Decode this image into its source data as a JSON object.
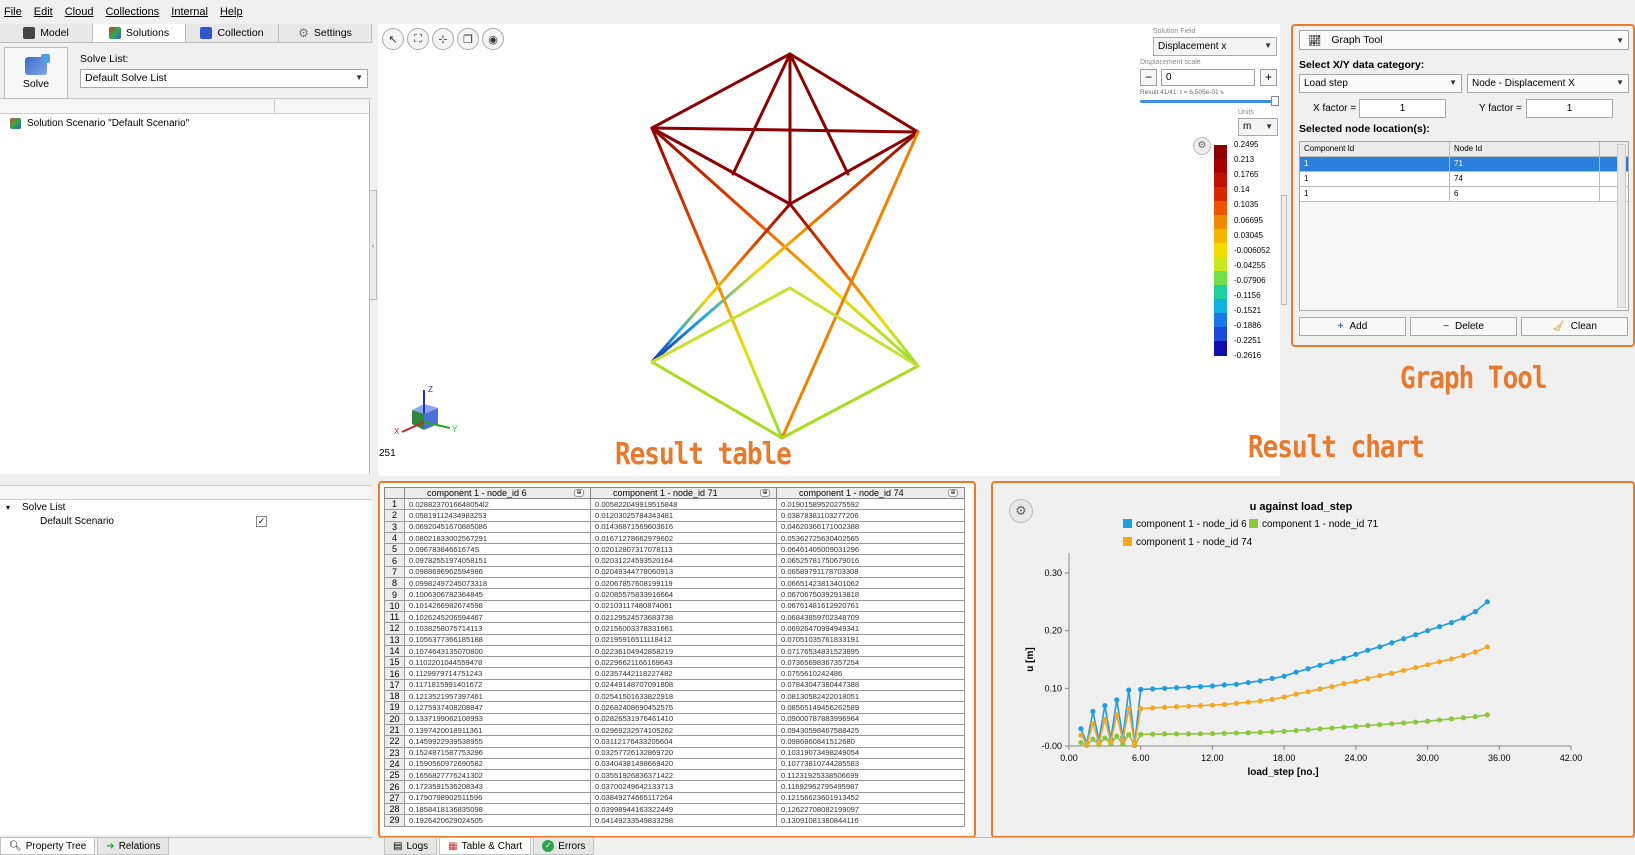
{
  "menu": [
    "File",
    "Edit",
    "Cloud",
    "Collections",
    "Internal",
    "Help"
  ],
  "left_tabs": [
    {
      "label": "Model",
      "icon": "model-icon",
      "color": "#444444"
    },
    {
      "label": "Solutions",
      "icon": "solutions-icon",
      "color": "#cc3322"
    },
    {
      "label": "Collection",
      "icon": "collection-icon",
      "color": "#3355cc"
    },
    {
      "label": "Settings",
      "icon": "gear-icon",
      "color": "#888888"
    }
  ],
  "solve": {
    "button_label": "Solve",
    "list_label": "Solve List:",
    "list_value": "Default Solve List"
  },
  "scenario": {
    "item": "Solution Scenario \"Default Scenario\""
  },
  "tree": {
    "root": "Solve List",
    "child": "Default Scenario",
    "checked": "✓"
  },
  "left_bottom_tabs": [
    {
      "label": "Property Tree",
      "icon": "search-icon"
    },
    {
      "label": "Relations",
      "icon": "arrow-icon"
    }
  ],
  "viewport": {
    "tools": [
      "select-icon",
      "fit-view-icon",
      "axes-icon",
      "layers-icon",
      "eye-icon"
    ],
    "solution_field_label": "Solution Field",
    "solution_field": "Displacement x",
    "displacement_scale_label": "Displacement scale",
    "displacement_scale": "0",
    "result_text": "Result 41/41: t = 6.505e-01 s",
    "result_progress": 1.0,
    "units_label": "Units",
    "units": "m",
    "frame_count": "251",
    "colorbar_labels": [
      "0.2495",
      "0.213",
      "0.1765",
      "0.14",
      "0.1035",
      "0.06695",
      "0.03045",
      "-0.006052",
      "-0.04255",
      "-0.07906",
      "-0.1156",
      "-0.1521",
      "-0.1886",
      "-0.2251",
      "-0.2616"
    ],
    "colorbar_colors": [
      "#8b0000",
      "#a50000",
      "#c01000",
      "#d82800",
      "#ee5500",
      "#f08a00",
      "#f4b400",
      "#f2dc00",
      "#c8e820",
      "#6fe04a",
      "#20cfa0",
      "#10b0e0",
      "#1a78e8",
      "#1e48d8",
      "#1010a8"
    ],
    "triad_labels": {
      "x": "X",
      "y": "Y",
      "z": "Z"
    }
  },
  "graph_tool": {
    "title": "Graph Tool",
    "category_label": "Select X/Y data category:",
    "x_category": "Load step",
    "y_category": "Node - Displacement X",
    "x_factor_label": "X factor =",
    "x_factor": "1",
    "y_factor_label": "Y factor =",
    "y_factor": "1",
    "nodes_label": "Selected node location(s):",
    "columns": [
      "Component Id",
      "Node Id"
    ],
    "rows": [
      [
        "1",
        "71"
      ],
      [
        "1",
        "74"
      ],
      [
        "1",
        "6"
      ]
    ],
    "buttons": {
      "add": "Add",
      "delete": "Delete",
      "clean": "Clean"
    }
  },
  "annotations": {
    "graph_tool": "Graph Tool",
    "result_table": "Result table",
    "result_chart": "Result chart"
  },
  "result_table": {
    "columns": [
      "component 1 - node_id 6",
      "component 1 - node_id 71",
      "component 1 - node_id 74"
    ],
    "rows": [
      [
        "1",
        "0.0288237016648054l2",
        "0.005822049919515848",
        "0.01901589520275592"
      ],
      [
        "2",
        "0.05819112434983253",
        "0.01203025784343481",
        "0.03878381103277206"
      ],
      [
        "3",
        "0.06920451670885086",
        "0.01436871569603616",
        "0.04620366171002388"
      ],
      [
        "4",
        "0.08021833002567291",
        "0.01671278662979602",
        "0.05362725630402565"
      ],
      [
        "5",
        "0.09678384661674S",
        "0.02012807317078113",
        "0.06461405009031296"
      ],
      [
        "6",
        "0.09782551974058151",
        "0.02031224593520164",
        "0.06525781750679016"
      ],
      [
        "7",
        "0.0988696962594986",
        "0.02049344778060913",
        "0.06589791178703308"
      ],
      [
        "8",
        "0.09982497245073318",
        "0.02067857608199119",
        "0.06651423813401062"
      ],
      [
        "9",
        "0.1006306782364845",
        "0.02085575833916664",
        "0.06706750392913818"
      ],
      [
        "10",
        "0.1014266982674598",
        "0.02103117480874061",
        "0.06761481612920761"
      ],
      [
        "11",
        "0.1026245206594467",
        "0.02129524573683738",
        "0.06843859702348709"
      ],
      [
        "12",
        "0.1038258075714113",
        "0.02156003378331661",
        "0.06926470994949341"
      ],
      [
        "13",
        "0.1056377366185188",
        "0.02195916511118412",
        "0.07051035761833191"
      ],
      [
        "14",
        "0.1074643135070800",
        "0.02236104942858219",
        "0.07176534831523895"
      ],
      [
        "15",
        "0.1102201044559478",
        "0.02296621166169643",
        "0.07365698367357254"
      ],
      [
        "16",
        "0.1129979714751243",
        "0.02357442118227482",
        "0.0755610242486"
      ],
      [
        "17",
        "0.1171815991401672",
        "0.02449148707091808",
        "0.07843047380447388"
      ],
      [
        "18",
        "0.1213521957397461",
        "0.02541501633822918",
        "0.08130582422018051"
      ],
      [
        "19",
        "0.1275937408208847",
        "0.02682408690452575",
        "0.08565149456262589"
      ],
      [
        "20",
        "0.1337199062108993",
        "0.02826531976461410",
        "0.09000787883996964"
      ],
      [
        "21",
        "0.1397420018911361",
        "0.02969232574105262",
        "0.09430598467588425"
      ],
      [
        "22",
        "0.1459922939538955",
        "0.03112176433205604",
        "0.0986860841512680"
      ],
      [
        "23",
        "0.1524871587753296",
        "0.03257726132869720",
        "0.10319073498249054"
      ],
      [
        "24",
        "0.1590560972690582",
        "0.03404381498669420",
        "0.10773810744285583"
      ],
      [
        "25",
        "0.1656827776241302",
        "0.03551926836371422",
        "0.11231925338506699"
      ],
      [
        "26",
        "0.1723591536208343",
        "0.03700249642133713",
        "0.11692962795495987"
      ],
      [
        "27",
        "0.1790798902511596",
        "0.03849274665117264",
        "0.12156623601913452"
      ],
      [
        "28",
        "0.1858418136835098",
        "0.03998944163322449",
        "0.12622708082199097"
      ],
      [
        "29",
        "0.1926420629024505",
        "0.04149233549833298",
        "0.13091081380844116"
      ]
    ]
  },
  "chart_data": {
    "type": "line",
    "title": "u against load_step",
    "xlabel": "load_step [no.]",
    "ylabel": "u [m]",
    "xlim": [
      0,
      42
    ],
    "ylim": [
      0,
      0.3
    ],
    "xticks": [
      "0.00",
      "6.00",
      "12.00",
      "18.00",
      "24.00",
      "30.00",
      "36.00",
      "42.00"
    ],
    "yticks": [
      "-0.00",
      "0.10",
      "0.20",
      "0.30"
    ],
    "legend_position": "top",
    "series": [
      {
        "name": "component 1 - node_id 6",
        "color": "#1f9de0",
        "x": [
          1,
          1.5,
          2,
          2.5,
          3,
          3.5,
          4,
          4.5,
          5,
          5.5,
          6,
          6,
          7,
          8,
          9,
          10,
          11,
          12,
          13,
          14,
          15,
          16,
          17,
          18,
          19,
          20,
          21,
          22,
          23,
          24,
          25,
          26,
          27,
          28,
          29,
          30,
          31,
          32,
          33,
          34,
          35
        ],
        "y": [
          0.03,
          0.005,
          0.06,
          0.01,
          0.07,
          0.012,
          0.08,
          0.015,
          0.097,
          0.005,
          0.098,
          0.098,
          0.099,
          0.1,
          0.101,
          0.102,
          0.103,
          0.104,
          0.106,
          0.107,
          0.11,
          0.113,
          0.117,
          0.121,
          0.128,
          0.134,
          0.14,
          0.146,
          0.152,
          0.159,
          0.166,
          0.172,
          0.179,
          0.186,
          0.193,
          0.2,
          0.207,
          0.214,
          0.222,
          0.233,
          0.25
        ]
      },
      {
        "name": "component 1 - node_id 71",
        "color": "#8cc63f",
        "x": [
          1,
          1.5,
          2,
          2.5,
          3,
          3.5,
          4,
          4.5,
          5,
          5.5,
          6,
          6,
          7,
          8,
          9,
          10,
          11,
          12,
          13,
          14,
          15,
          16,
          17,
          18,
          19,
          20,
          21,
          22,
          23,
          24,
          25,
          26,
          27,
          28,
          29,
          30,
          31,
          32,
          33,
          34,
          35
        ],
        "y": [
          0.006,
          0.001,
          0.012,
          0.002,
          0.014,
          0.003,
          0.017,
          0.003,
          0.02,
          0.001,
          0.02,
          0.02,
          0.0205,
          0.021,
          0.0209,
          0.021,
          0.0213,
          0.0216,
          0.022,
          0.0224,
          0.023,
          0.0236,
          0.0245,
          0.0254,
          0.0268,
          0.0283,
          0.0297,
          0.0311,
          0.0326,
          0.034,
          0.0355,
          0.037,
          0.0385,
          0.04,
          0.0415,
          0.043,
          0.045,
          0.047,
          0.049,
          0.051,
          0.054
        ]
      },
      {
        "name": "component 1 - node_id 74",
        "color": "#f5a623",
        "x": [
          1,
          1.5,
          2,
          2.5,
          3,
          3.5,
          4,
          4.5,
          5,
          5.5,
          6,
          6,
          7,
          8,
          9,
          10,
          11,
          12,
          13,
          14,
          15,
          16,
          17,
          18,
          19,
          20,
          21,
          22,
          23,
          24,
          25,
          26,
          27,
          28,
          29,
          30,
          31,
          32,
          33,
          34,
          35
        ],
        "y": [
          0.019,
          0.003,
          0.039,
          0.006,
          0.046,
          0.008,
          0.054,
          0.01,
          0.065,
          0.003,
          0.065,
          0.065,
          0.066,
          0.067,
          0.068,
          0.069,
          0.07,
          0.071,
          0.072,
          0.074,
          0.076,
          0.078,
          0.081,
          0.085,
          0.09,
          0.094,
          0.099,
          0.103,
          0.108,
          0.112,
          0.117,
          0.122,
          0.126,
          0.131,
          0.136,
          0.141,
          0.146,
          0.151,
          0.157,
          0.163,
          0.172
        ]
      }
    ]
  },
  "center_bottom_tabs": [
    {
      "label": "Logs",
      "icon": "logs-icon"
    },
    {
      "label": "Table & Chart",
      "icon": "table-chart-icon"
    },
    {
      "label": "Errors",
      "icon": "check-icon"
    }
  ]
}
